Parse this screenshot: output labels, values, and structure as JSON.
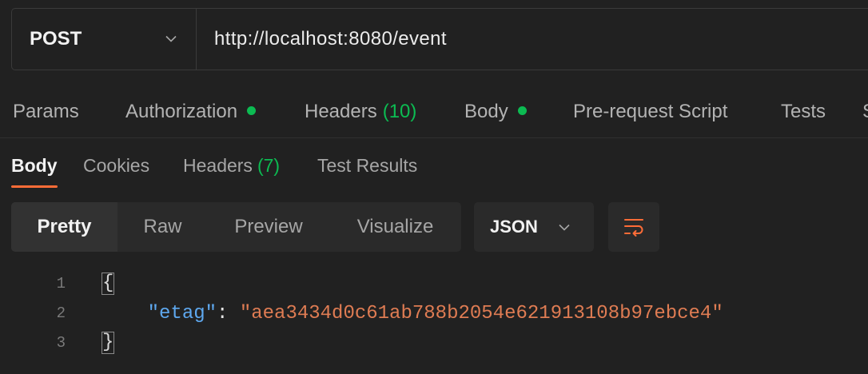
{
  "request": {
    "method": "POST",
    "method_icon": "chevron-down-icon",
    "url": "http://localhost:8080/event"
  },
  "request_tabs": [
    {
      "label": "Params"
    },
    {
      "label": "Authorization",
      "has_indicator": true
    },
    {
      "label": "Headers",
      "count": "(10)"
    },
    {
      "label": "Body",
      "has_indicator": true
    },
    {
      "label": "Pre-request Script"
    },
    {
      "label": "Tests"
    },
    {
      "label": "S"
    }
  ],
  "response": {
    "tabs": [
      {
        "label": "Body",
        "active": true
      },
      {
        "label": "Cookies"
      },
      {
        "label": "Headers",
        "count": "(7)"
      },
      {
        "label": "Test Results"
      }
    ],
    "view_modes": [
      "Pretty",
      "Raw",
      "Preview",
      "Visualize"
    ],
    "selected_view_index": 0,
    "format": "JSON",
    "format_icon": "chevron-down-icon",
    "wrap_icon": "wrap-lines-icon",
    "body": {
      "line_numbers": [
        "1",
        "2",
        "3"
      ],
      "open_brace": "{",
      "key": "\"etag\"",
      "colon": ":",
      "value": "\"aea3434d0c61ab788b2054e621913108b97ebce4\"",
      "close_brace": "}"
    }
  },
  "colors": {
    "bg": "#212121",
    "accent": "#ff6c37",
    "indicator": "#0cbb52",
    "json_key": "#5ea8ef",
    "json_string": "#df7c53"
  }
}
